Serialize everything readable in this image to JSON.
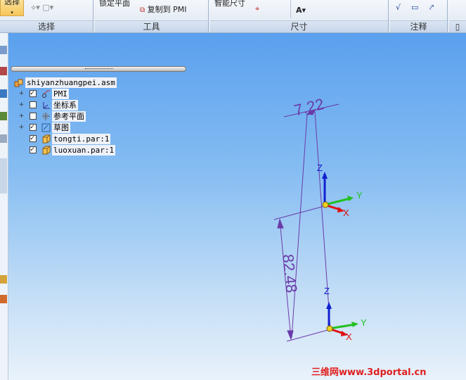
{
  "ribbon": {
    "groups": [
      {
        "label": "选择"
      },
      {
        "label": "工具"
      },
      {
        "label": "尺寸"
      },
      {
        "label": "注释"
      }
    ],
    "select_button": "选择",
    "lock_plane": "锁定平面",
    "copy_to_pmi": "复制到 PMI",
    "smart_dimension": "智能尺寸"
  },
  "tree": {
    "root": "shiyanzhuangpei.asm",
    "items": [
      {
        "label": "PMI",
        "checked": true,
        "expandable": true
      },
      {
        "label": "坐标系",
        "checked": false,
        "expandable": true
      },
      {
        "label": "参考平面",
        "checked": false,
        "expandable": true
      },
      {
        "label": "草图",
        "checked": true,
        "expandable": true
      },
      {
        "label": "tongti.par:1",
        "checked": true,
        "expandable": false
      },
      {
        "label": "luoxuan.par:1",
        "checked": true,
        "expandable": false
      }
    ]
  },
  "model": {
    "dim_top": "7.22",
    "dim_side": "82.48",
    "axis_z": "Z",
    "axis_y": "Y",
    "axis_x": "X",
    "axis_z2": "Z",
    "axis_y2": "Y",
    "axis_x2": "X"
  },
  "colors": {
    "dimension": "#6a3aa8",
    "axis_x": "#e01010",
    "axis_y": "#22c022",
    "axis_z": "#1020d0"
  },
  "watermark": "三维网www.3dportal.cn"
}
